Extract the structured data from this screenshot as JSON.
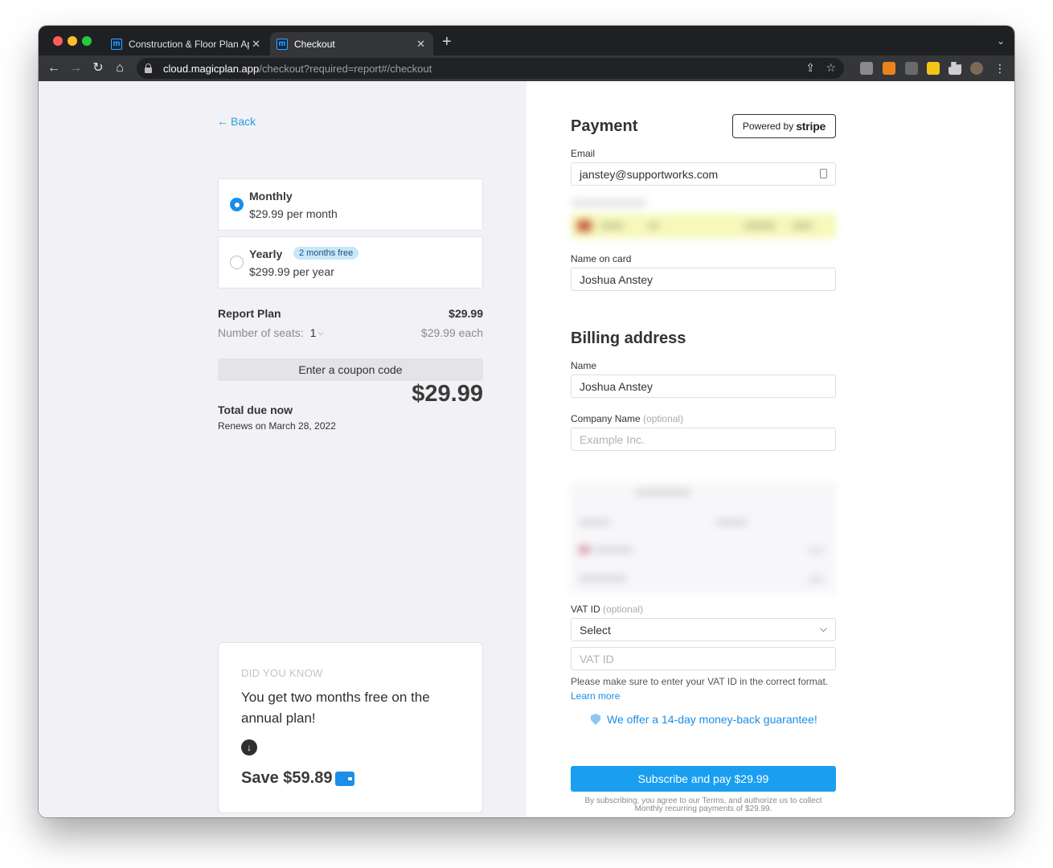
{
  "browser": {
    "tabs": [
      {
        "title": "Construction & Floor Plan App",
        "active": false
      },
      {
        "title": "Checkout",
        "active": true
      }
    ],
    "url_host": "cloud.magicplan.app",
    "url_path": "/checkout?required=report#/checkout"
  },
  "summary": {
    "back_label": "Back",
    "plans": [
      {
        "name": "Monthly",
        "price": "$29.99 per month",
        "selected": true
      },
      {
        "name": "Yearly",
        "badge": "2 months free",
        "price": "$299.99 per year",
        "selected": false
      }
    ],
    "plan_name": "Report Plan",
    "plan_amount": "$29.99",
    "seats_label": "Number of seats:",
    "seats_value": "1",
    "seats_each": "$29.99 each",
    "coupon_label": "Enter a coupon code",
    "total_label": "Total due now",
    "renews": "Renews on March 28, 2022",
    "total_amount": "$29.99"
  },
  "did_you_know": {
    "label": "DID YOU KNOW",
    "text": "You get two months free on the annual plan!",
    "save": "Save $59.89"
  },
  "payment": {
    "title": "Payment",
    "powered_by": "Powered by",
    "stripe": "stripe",
    "email_label": "Email",
    "email_value": "janstey@supportworks.com",
    "name_on_card_label": "Name on card",
    "name_on_card_value": "Joshua Anstey"
  },
  "billing": {
    "title": "Billing address",
    "name_label": "Name",
    "name_value": "Joshua Anstey",
    "company_label": "Company Name",
    "optional": "(optional)",
    "company_placeholder": "Example Inc.",
    "vat_label": "VAT ID",
    "vat_select": "Select",
    "vat_placeholder": "VAT ID",
    "vat_help": "Please make sure to enter your VAT ID in the correct format.",
    "learn_more": "Learn more"
  },
  "footer": {
    "guarantee": "We offer a 14-day money-back guarantee!",
    "subscribe": "Subscribe and pay $29.99",
    "legal_line1": "By subscribing, you agree to our Terms, and authorize us to collect",
    "legal_line2": "Monthly recurring payments of $29.99."
  },
  "colors": {
    "accent": "#1a9ef0",
    "link": "#2a9be0",
    "left_bg": "#f2f2f6"
  }
}
